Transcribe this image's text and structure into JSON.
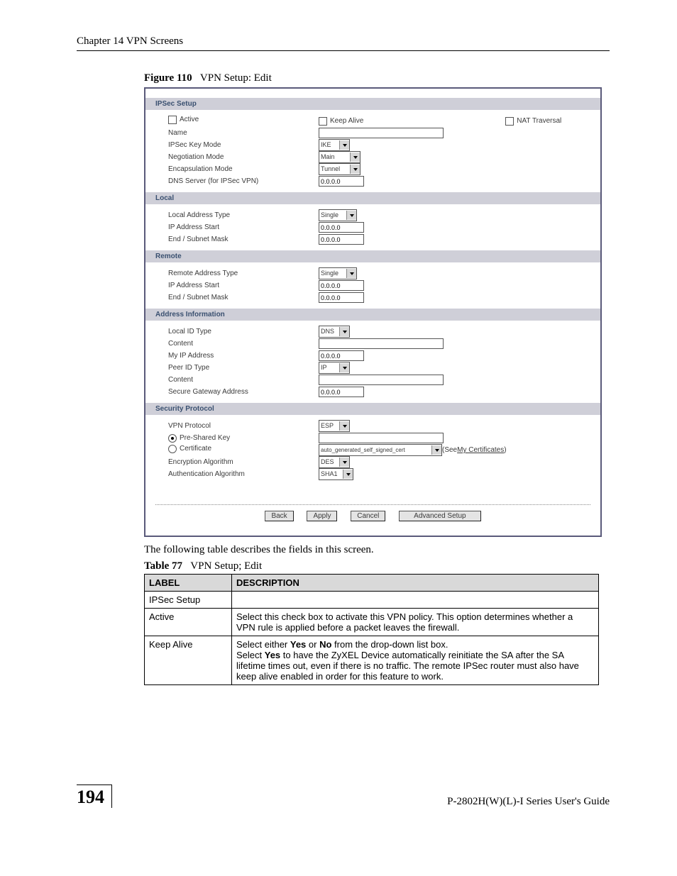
{
  "page": {
    "chapter": "Chapter 14 VPN Screens",
    "figure_label": "Figure 110",
    "figure_title": "VPN Setup: Edit",
    "body_text": "The following table describes the fields in this screen.",
    "table_label": "Table 77",
    "table_title": "VPN Setup; Edit",
    "page_number": "194",
    "guide": "P-2802H(W)(L)-I Series User's Guide"
  },
  "screenshot": {
    "sections": {
      "ipsec_setup": "IPSec Setup",
      "local": "Local",
      "remote": "Remote",
      "address_info": "Address Information",
      "security_protocol": "Security Protocol"
    },
    "ipsec": {
      "active": "Active",
      "keep_alive": "Keep Alive",
      "nat_traversal": "NAT Traversal",
      "name": "Name",
      "name_value": "",
      "ipsec_key_mode": "IPSec Key Mode",
      "ipsec_key_mode_value": "IKE",
      "negotiation_mode": "Negotiation Mode",
      "negotiation_mode_value": "Main",
      "encapsulation_mode": "Encapsulation Mode",
      "encapsulation_mode_value": "Tunnel",
      "dns_server": "DNS Server (for IPSec VPN)",
      "dns_server_value": "0.0.0.0"
    },
    "local_sec": {
      "address_type": "Local Address Type",
      "address_type_value": "Single",
      "ip_start": "IP Address Start",
      "ip_start_value": "0.0.0.0",
      "end_mask": "End / Subnet Mask",
      "end_mask_value": "0.0.0.0"
    },
    "remote_sec": {
      "address_type": "Remote Address Type",
      "address_type_value": "Single",
      "ip_start": "IP Address Start",
      "ip_start_value": "0.0.0.0",
      "end_mask": "End / Subnet Mask",
      "end_mask_value": "0.0.0.0"
    },
    "address": {
      "local_id_type": "Local ID Type",
      "local_id_type_value": "DNS",
      "content1": "Content",
      "content1_value": "",
      "my_ip": "My IP Address",
      "my_ip_value": "0.0.0.0",
      "peer_id_type": "Peer ID Type",
      "peer_id_type_value": "IP",
      "content2": "Content",
      "content2_value": "",
      "secure_gw": "Secure Gateway Address",
      "secure_gw_value": "0.0.0.0"
    },
    "security": {
      "vpn_protocol": "VPN Protocol",
      "vpn_protocol_value": "ESP",
      "psk": "Pre-Shared Key",
      "psk_value": "",
      "cert": "Certificate",
      "cert_value": "auto_generated_self_signed_cert",
      "cert_see": "(See ",
      "cert_link": "My Certificates",
      "cert_close": ")",
      "enc_alg": "Encryption Algorithm",
      "enc_alg_value": "DES",
      "auth_alg": "Authentication Algorithm",
      "auth_alg_value": "SHA1"
    },
    "buttons": {
      "back": "Back",
      "apply": "Apply",
      "cancel": "Cancel",
      "advanced": "Advanced Setup"
    }
  },
  "table": {
    "th_label": "LABEL",
    "th_desc": "DESCRIPTION",
    "rows": [
      {
        "label": "IPSec Setup",
        "desc": ""
      },
      {
        "label": "Active",
        "desc": "Select this check box to activate this VPN policy. This option determines whether a VPN rule is applied before a packet leaves the firewall."
      },
      {
        "label": "Keep Alive",
        "desc_line1": "Select either ",
        "desc_b1": "Yes",
        "desc_mid1": " or ",
        "desc_b2": "No",
        "desc_tail1": " from the drop-down list box.",
        "desc_line2a": "Select ",
        "desc_b3": "Yes",
        "desc_line2b": " to have the ZyXEL Device automatically reinitiate the SA after the SA lifetime times out, even if there is no traffic. The remote IPSec router must also have keep alive enabled in order for this feature to work."
      }
    ]
  }
}
